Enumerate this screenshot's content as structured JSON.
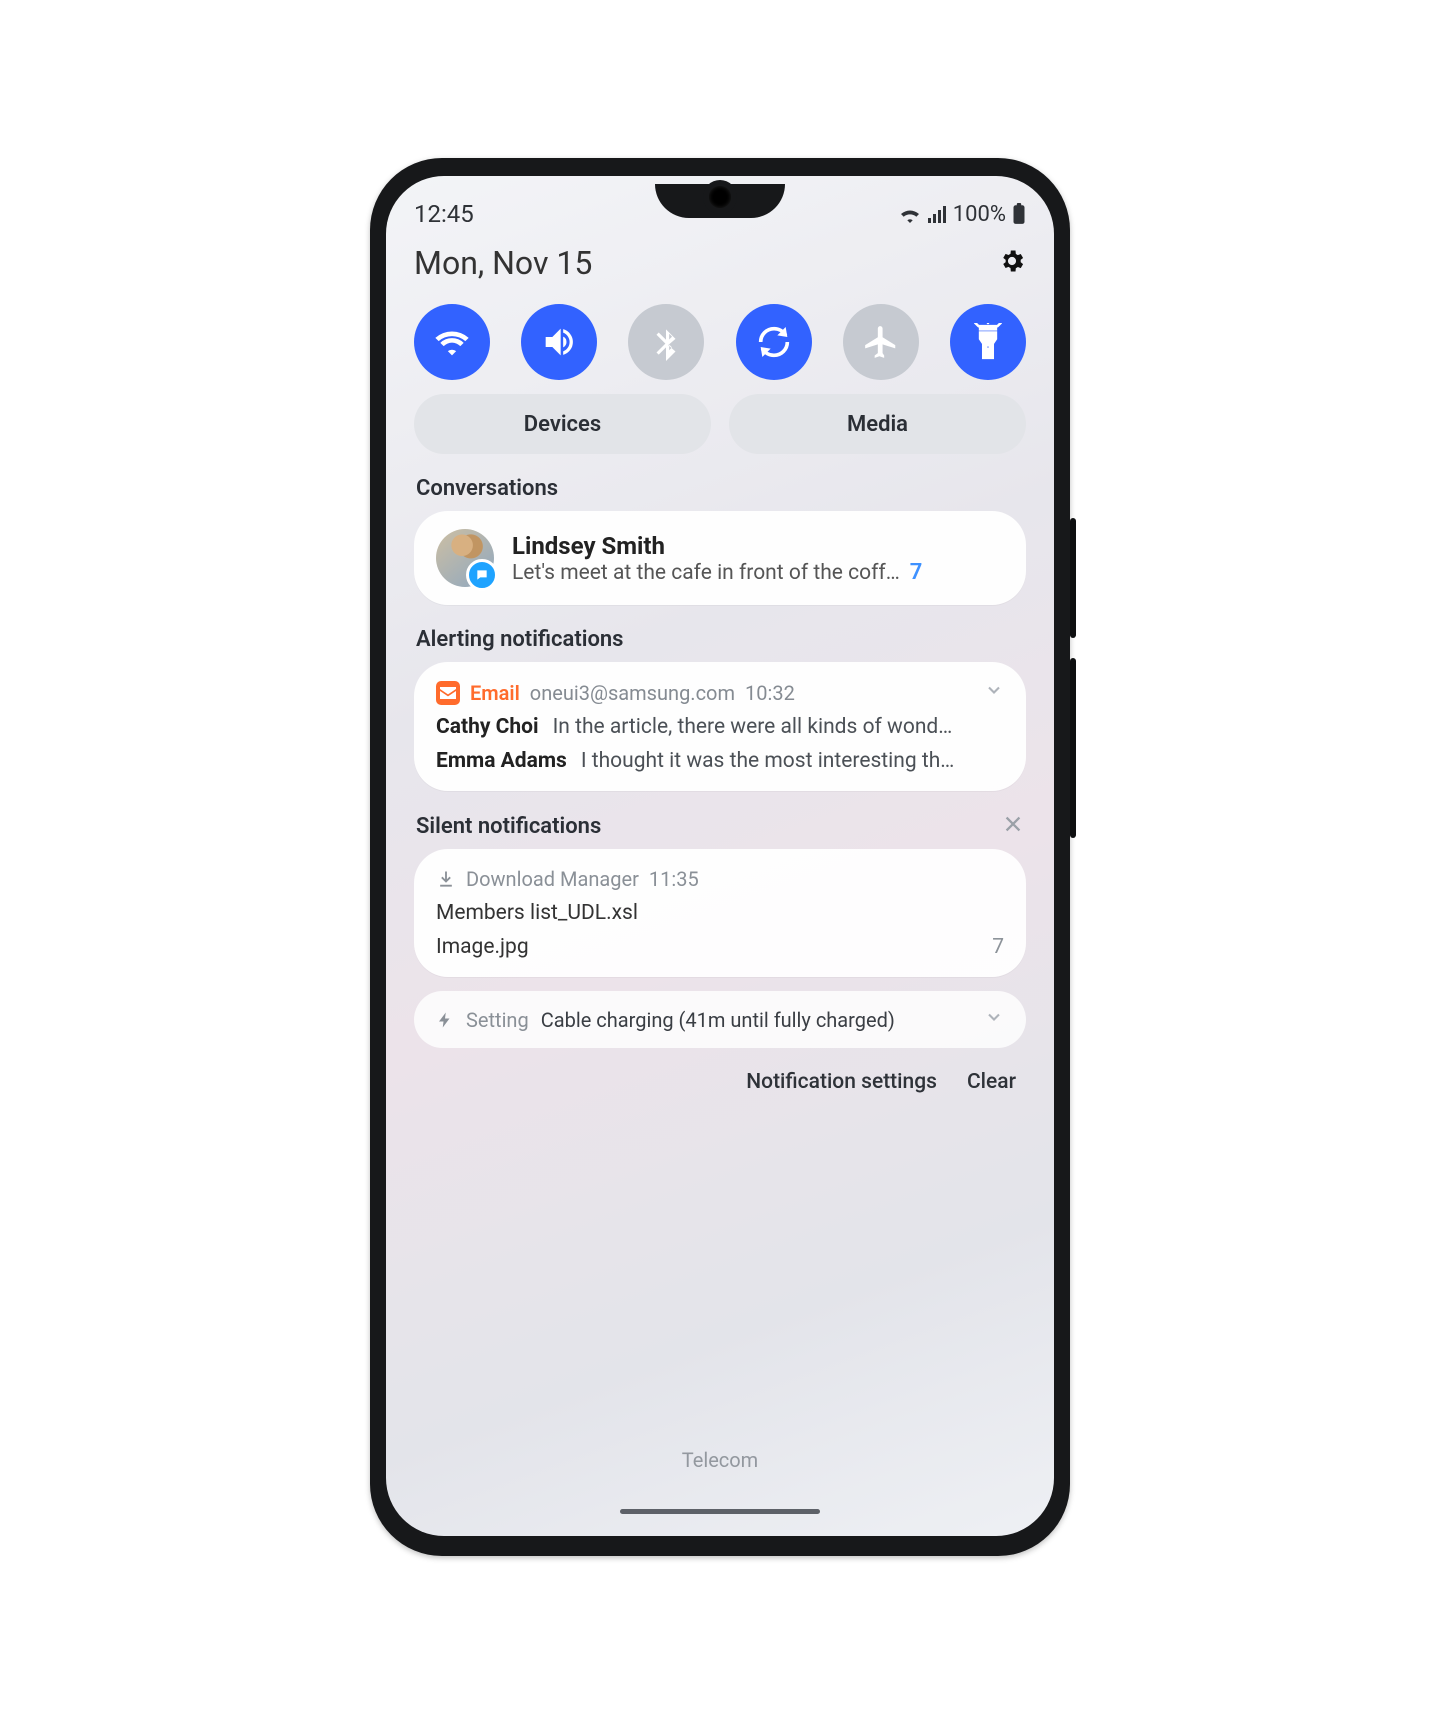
{
  "status": {
    "time": "12:45",
    "battery": "100%"
  },
  "header": {
    "date": "Mon, Nov 15"
  },
  "quick_toggles": [
    {
      "name": "wifi",
      "on": true
    },
    {
      "name": "sound",
      "on": true
    },
    {
      "name": "bluetooth",
      "on": false
    },
    {
      "name": "autorotate",
      "on": true
    },
    {
      "name": "airplane",
      "on": false
    },
    {
      "name": "flashlight",
      "on": true
    }
  ],
  "panel_buttons": {
    "devices": "Devices",
    "media": "Media"
  },
  "sections": {
    "conversations": {
      "title": "Conversations",
      "item": {
        "name": "Lindsey Smith",
        "message": "Let's meet at the cafe in front of the coff…",
        "count": "7"
      }
    },
    "alerting": {
      "title": "Alerting notifications",
      "email": {
        "app_label": "Email",
        "account": "oneui3@samsung.com",
        "time": "10:32",
        "rows": [
          {
            "sender": "Cathy Choi",
            "subject": "In the article, there were all kinds of wond…"
          },
          {
            "sender": "Emma Adams",
            "subject": "I thought it was the most interesting th…"
          }
        ]
      }
    },
    "silent": {
      "title": "Silent notifications",
      "download": {
        "app_label": "Download Manager",
        "time": "11:35",
        "files": [
          {
            "name": "Members list_UDL.xsl",
            "count": ""
          },
          {
            "name": "Image.jpg",
            "count": "7"
          }
        ]
      },
      "charging": {
        "src_label": "Setting",
        "text": "Cable charging (41m until fully charged)"
      }
    }
  },
  "footer": {
    "settings": "Notification settings",
    "clear": "Clear"
  },
  "carrier": "Telecom"
}
